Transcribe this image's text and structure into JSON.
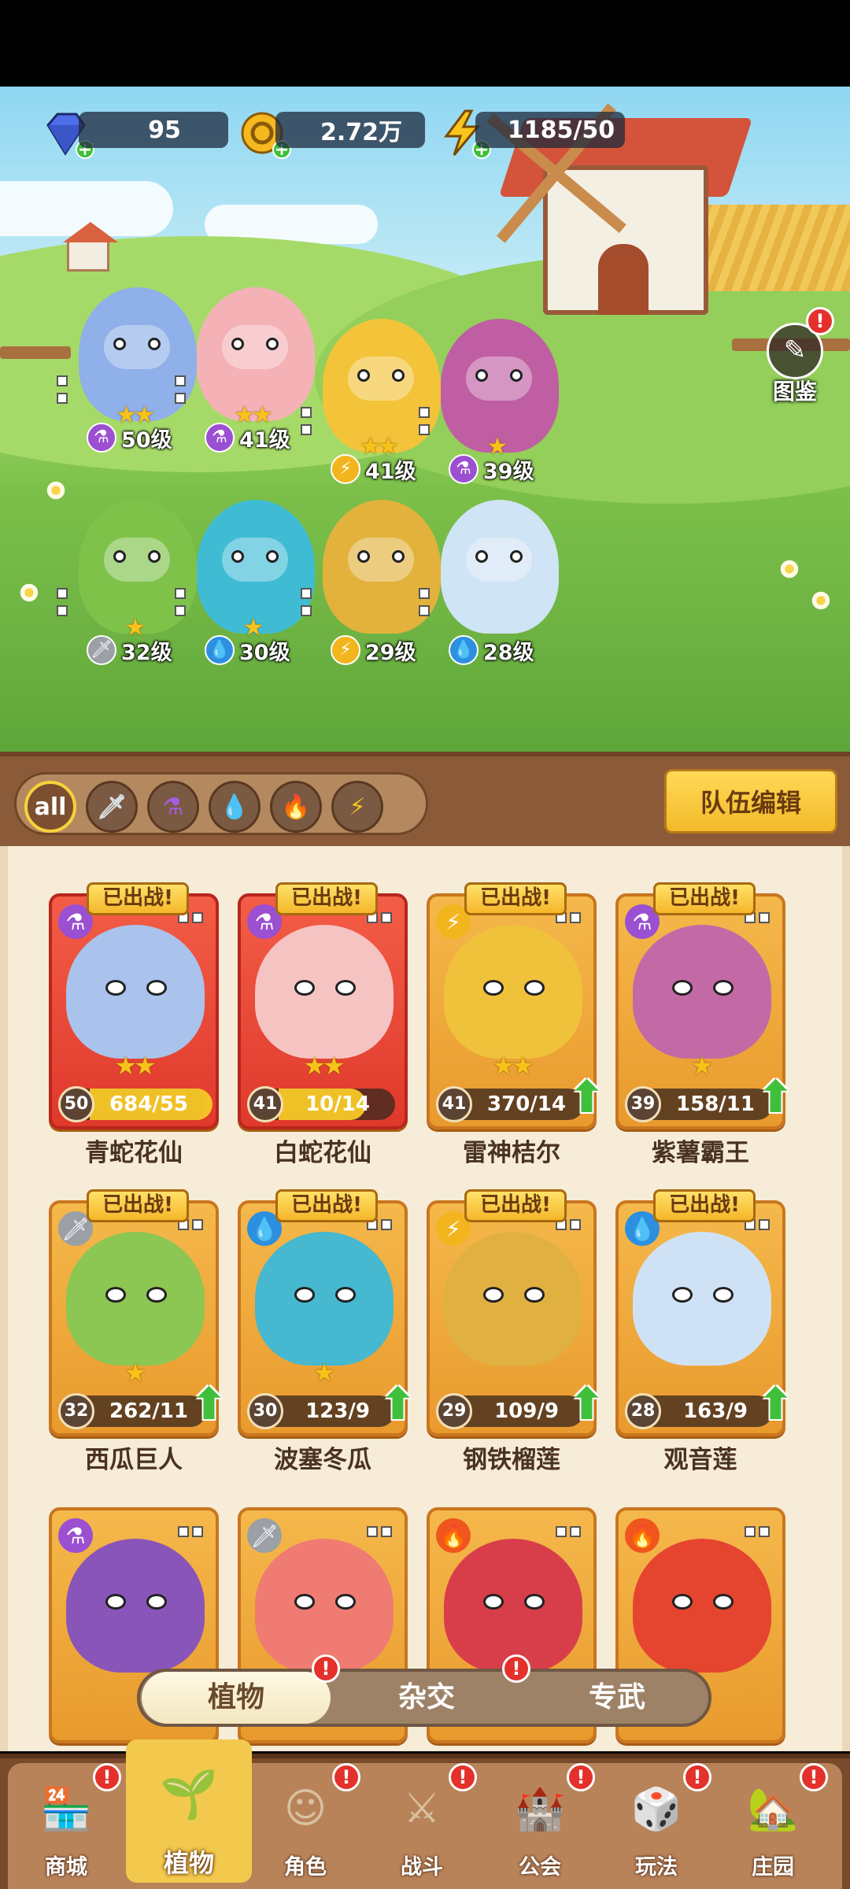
{
  "resources": {
    "gems": "95",
    "coins": "2.72万",
    "energy": "1185/50"
  },
  "atlas": {
    "label": "图鉴",
    "badge": "!"
  },
  "team": [
    {
      "level": "50级",
      "element": "poison",
      "stars": "★★",
      "color": "#8fb0e8"
    },
    {
      "level": "41级",
      "element": "poison",
      "stars": "★★",
      "color": "#f4b2b7"
    },
    {
      "level": "41级",
      "element": "thunder",
      "stars": "★★",
      "color": "#f3c33a"
    },
    {
      "level": "39级",
      "element": "poison",
      "stars": "★",
      "color": "#c05ea3"
    },
    {
      "level": "32级",
      "element": "sword",
      "stars": "★",
      "color": "#7fc24a"
    },
    {
      "level": "30级",
      "element": "water",
      "stars": "★",
      "color": "#3fbcd4"
    },
    {
      "level": "29级",
      "element": "thunder",
      "stars": "",
      "color": "#e2b23c"
    },
    {
      "level": "28级",
      "element": "water",
      "stars": "",
      "color": "#cfe4f5"
    }
  ],
  "filters": {
    "all": "all",
    "icons": [
      "sword-icon",
      "potion-icon",
      "water-icon",
      "fire-icon",
      "thunder-icon"
    ]
  },
  "team_edit_label": "队伍编辑",
  "deployed_label": "已出战!",
  "cards": [
    {
      "name": "青蛇花仙",
      "level": "50",
      "progress": "684/55",
      "fill": 1.0,
      "stars": "★★",
      "element": "poison",
      "red": true,
      "color": "#a9c3ec",
      "up": false,
      "deployed": true
    },
    {
      "name": "白蛇花仙",
      "level": "41",
      "progress": "10/14",
      "fill": 0.71,
      "stars": "★★",
      "element": "poison",
      "red": true,
      "color": "#f6c3c3",
      "up": false,
      "deployed": true
    },
    {
      "name": "雷神桔尔",
      "level": "41",
      "progress": "370/14",
      "fill": 0,
      "stars": "★★",
      "element": "thunder",
      "red": false,
      "color": "#f0c23b",
      "up": true,
      "deployed": true
    },
    {
      "name": "紫薯霸王",
      "level": "39",
      "progress": "158/11",
      "fill": 0,
      "stars": "★",
      "element": "poison",
      "red": false,
      "color": "#c36aa6",
      "up": true,
      "deployed": true
    },
    {
      "name": "西瓜巨人",
      "level": "32",
      "progress": "262/11",
      "fill": 0,
      "stars": "★",
      "element": "sword",
      "red": false,
      "color": "#8cc653",
      "up": true,
      "deployed": true
    },
    {
      "name": "波塞冬瓜",
      "level": "30",
      "progress": "123/9",
      "fill": 0,
      "stars": "★",
      "element": "water",
      "red": false,
      "color": "#46b8cf",
      "up": true,
      "deployed": true
    },
    {
      "name": "钢铁榴莲",
      "level": "29",
      "progress": "109/9",
      "fill": 0,
      "stars": "",
      "element": "thunder",
      "red": false,
      "color": "#e0b040",
      "up": true,
      "deployed": true
    },
    {
      "name": "观音莲",
      "level": "28",
      "progress": "163/9",
      "fill": 0,
      "stars": "",
      "element": "water",
      "red": false,
      "color": "#cfe2f5",
      "up": true,
      "deployed": true
    },
    {
      "name": "",
      "level": "",
      "progress": "",
      "fill": 0,
      "stars": "",
      "element": "poison",
      "red": false,
      "color": "#8a55b8",
      "up": false,
      "deployed": false
    },
    {
      "name": "",
      "level": "",
      "progress": "",
      "fill": 0,
      "stars": "",
      "element": "sword",
      "red": false,
      "color": "#f07b72",
      "up": false,
      "deployed": false
    },
    {
      "name": "",
      "level": "",
      "progress": "",
      "fill": 0,
      "stars": "",
      "element": "fire",
      "red": false,
      "color": "#d83e4a",
      "up": false,
      "deployed": false
    },
    {
      "name": "",
      "level": "",
      "progress": "",
      "fill": 0,
      "stars": "",
      "element": "fire",
      "red": false,
      "color": "#e5452f",
      "up": false,
      "deployed": false
    }
  ],
  "subtabs": [
    "植物",
    "杂交",
    "专武"
  ],
  "nav": [
    {
      "label": "商城",
      "icon": "shop-icon",
      "active": false
    },
    {
      "label": "植物",
      "icon": "plant-icon",
      "active": true
    },
    {
      "label": "角色",
      "icon": "character-icon",
      "active": false
    },
    {
      "label": "战斗",
      "icon": "battle-icon",
      "active": false
    },
    {
      "label": "公会",
      "icon": "guild-icon",
      "active": false
    },
    {
      "label": "玩法",
      "icon": "gameplay-icon",
      "active": false
    },
    {
      "label": "庄园",
      "icon": "manor-icon",
      "active": false
    }
  ],
  "colors": {
    "poison": "#9b4fd1",
    "thunder": "#f3b51e",
    "water": "#2d8fe0",
    "fire": "#f0551e",
    "sword": "#9aa0a6"
  }
}
